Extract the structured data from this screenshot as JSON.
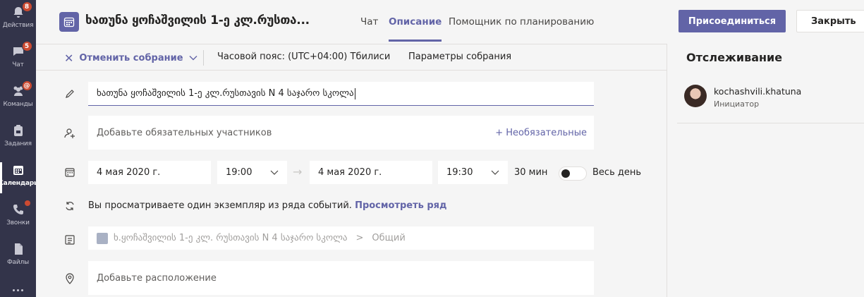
{
  "rail": {
    "items": [
      {
        "label": "Действия",
        "badge": "8"
      },
      {
        "label": "Чат",
        "badge": "5"
      },
      {
        "label": "Команды",
        "badge": "@"
      },
      {
        "label": "Задания"
      },
      {
        "label": "Календарь"
      },
      {
        "label": "Звонки"
      },
      {
        "label": "Файлы"
      }
    ]
  },
  "header": {
    "title": "ხათუნა ყოჩაშვილის 1-ე კლ.რუსთა...",
    "tabs": [
      {
        "label": "Чат"
      },
      {
        "label": "Описание"
      },
      {
        "label": "Помощник по планированию"
      }
    ],
    "join_label": "Присоединиться",
    "close_label": "Закрыть"
  },
  "toolbar": {
    "cancel_label": "Отменить собрание",
    "timezone": "Часовой пояс: (UTC+04:00) Тбилиси",
    "options": "Параметры собрания"
  },
  "form": {
    "title_value": "ხათუნა ყოჩაშვილის 1-ე კლ.რუსთავის N 4 საჯარო სკოლა",
    "attendees_placeholder": "Добавьте обязательных участников",
    "optional_link": "+ Необязательные",
    "start_date": "4 мая 2020 г.",
    "start_time": "19:00",
    "end_date": "4 мая 2020 г.",
    "end_time": "19:30",
    "duration": "30 мин",
    "all_day_label": "Весь день",
    "series_text": "Вы просматриваете один экземпляр из ряда событий.",
    "series_link": "Просмотреть ряд",
    "channel_team": "ხ.ყოჩაშვილის 1-ე კლ. რუსთავის N 4 საჯარო სკოლა",
    "channel_sep": ">",
    "channel_name": "Общий",
    "location_placeholder": "Добавьте расположение"
  },
  "right_pane": {
    "title": "Отслеживание",
    "attendee_name": "kochashvili.khatuna",
    "attendee_role": "Инициатор"
  },
  "colors": {
    "accent": "#6264a7",
    "rail_bg": "#33344a",
    "badge": "#cc4a31"
  }
}
